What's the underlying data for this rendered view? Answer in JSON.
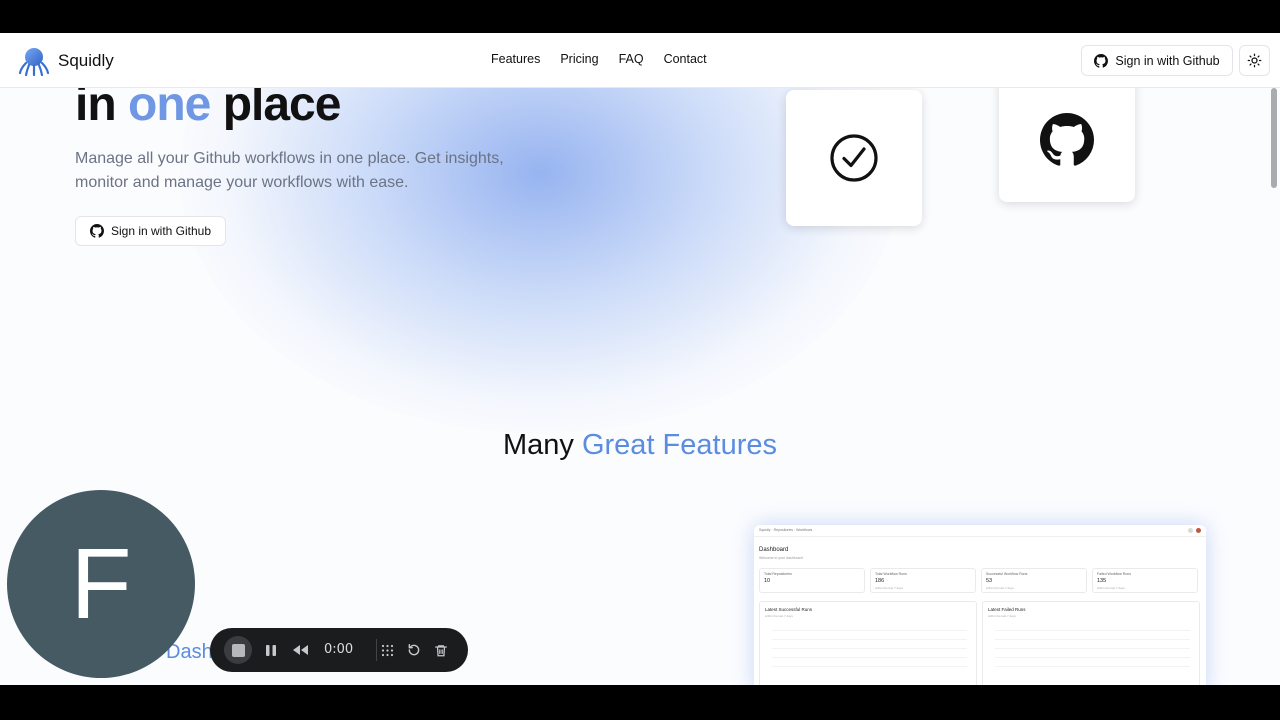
{
  "navbar": {
    "brand": "Squidly",
    "links": [
      "Features",
      "Pricing",
      "FAQ",
      "Contact"
    ],
    "signin_label": "Sign in with Github",
    "theme_icon": "sun-icon"
  },
  "hero": {
    "title_start": "in",
    "title_accent": "one",
    "title_end": "place",
    "subtitle": "Manage all your Github workflows in one place. Get insights, monitor and manage your workflows with ease.",
    "signin_label": "Sign in with Github",
    "cards": [
      "check-circle-icon",
      "github-icon"
    ]
  },
  "features": {
    "title_start": "Many",
    "title_accent": "Great Features",
    "dashboard_label": "Dash"
  },
  "dashboard_preview": {
    "crumb": "Squidly · Repositories · Workflows",
    "title": "Dashboard",
    "subtitle": "Welcome to your dashboard",
    "stats": [
      {
        "title": "Total Repositories",
        "value": "10",
        "sub": ""
      },
      {
        "title": "Total Workflow Runs",
        "value": "186",
        "sub": "within the last 7 days"
      },
      {
        "title": "Successful Workflow Runs",
        "value": "53",
        "sub": "within the last 7 days"
      },
      {
        "title": "Failed Workflow Runs",
        "value": "135",
        "sub": "within the last 7 days"
      }
    ],
    "panels": [
      {
        "title": "Latest Successful Runs",
        "sub": "within the last 7 days"
      },
      {
        "title": "Latest Failed Runs",
        "sub": "within the last 7 days"
      }
    ]
  },
  "webcam": {
    "initial": "F"
  },
  "recorder": {
    "time": "0:00",
    "icons": [
      "stop-icon",
      "pause-icon",
      "rewind-icon",
      "grid-icon",
      "restart-icon",
      "trash-icon"
    ]
  }
}
